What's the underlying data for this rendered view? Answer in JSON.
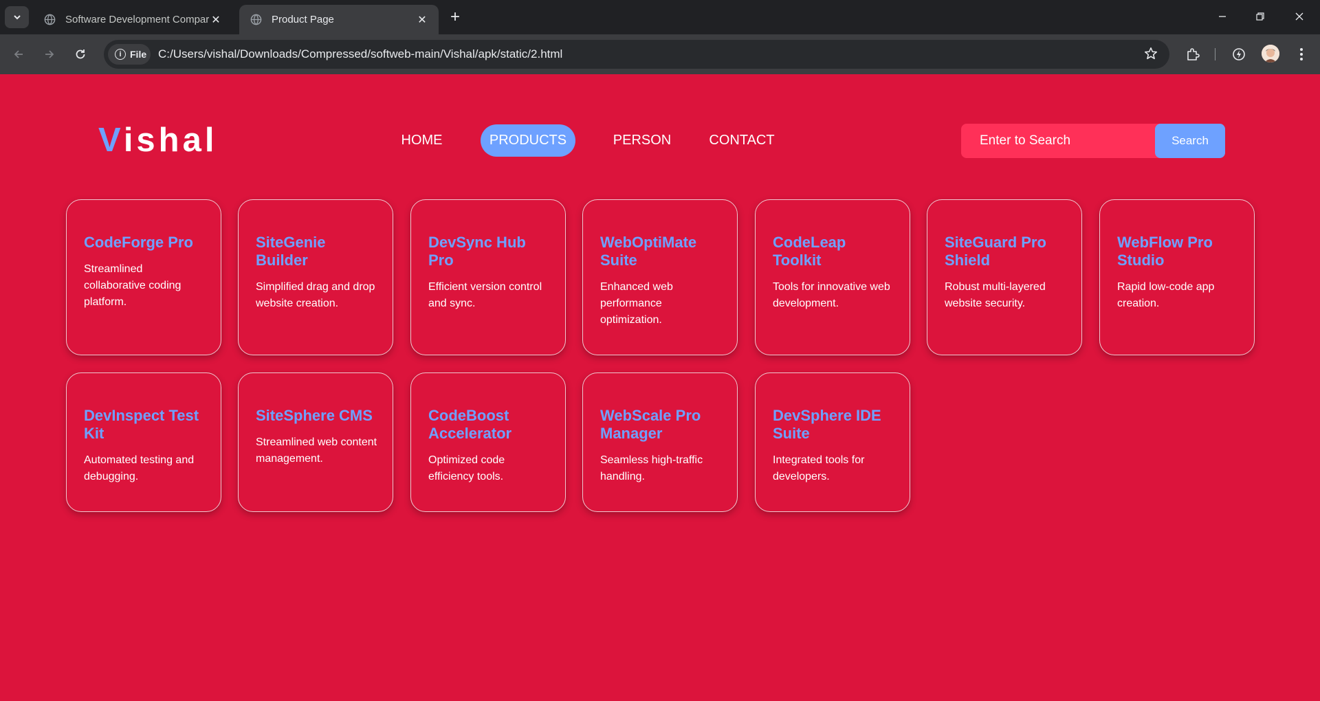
{
  "browser": {
    "tabs": [
      {
        "title": "Software Development Compar",
        "active": false
      },
      {
        "title": "Product Page",
        "active": true
      }
    ],
    "chip_label": "File",
    "url": "C:/Users/vishal/Downloads/Compressed/softweb-main/Vishal/apk/static/2.html"
  },
  "header": {
    "logo_first": "V",
    "logo_rest": "ishal",
    "nav": [
      {
        "label": "HOME",
        "active": false
      },
      {
        "label": "PRODUCTS",
        "active": true
      },
      {
        "label": "PERSON",
        "active": false
      },
      {
        "label": "CONTACT",
        "active": false
      }
    ],
    "search": {
      "placeholder": "Enter to Search",
      "button": "Search"
    }
  },
  "products": [
    {
      "name": "CodeForge Pro",
      "desc": "Streamlined collaborative coding platform."
    },
    {
      "name": "SiteGenie Builder",
      "desc": "Simplified drag and drop website creation."
    },
    {
      "name": "DevSync Hub Pro",
      "desc": "Efficient version control and sync."
    },
    {
      "name": "WebOptiMate Suite",
      "desc": "Enhanced web performance optimization."
    },
    {
      "name": "CodeLeap Toolkit",
      "desc": "Tools for innovative web development."
    },
    {
      "name": "SiteGuard Pro Shield",
      "desc": "Robust multi-layered website security."
    },
    {
      "name": "WebFlow Pro Studio",
      "desc": "Rapid low-code app creation."
    },
    {
      "name": "DevInspect Test Kit",
      "desc": "Automated testing and debugging."
    },
    {
      "name": "SiteSphere CMS",
      "desc": "Streamlined web content management."
    },
    {
      "name": "CodeBoost Accelerator",
      "desc": "Optimized code efficiency tools."
    },
    {
      "name": "WebScale Pro Manager",
      "desc": "Seamless high-traffic handling."
    },
    {
      "name": "DevSphere IDE Suite",
      "desc": "Integrated tools for developers."
    }
  ],
  "colors": {
    "page_bg": "#dc143c",
    "accent": "#6ea1ff",
    "search_bg": "#ff3058",
    "chrome_bg": "#202124",
    "toolbar_bg": "#3c3d40"
  }
}
